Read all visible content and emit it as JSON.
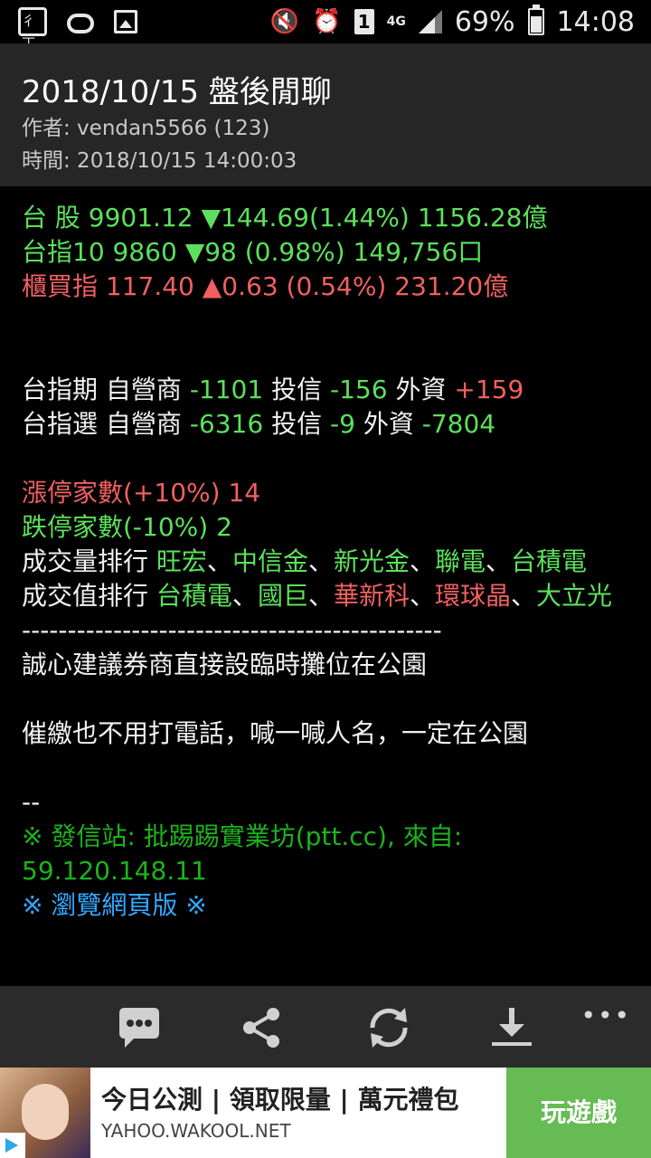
{
  "status_bar": {
    "battery": "69%",
    "time": "14:08",
    "sim_slot": "1",
    "network": "4G"
  },
  "header": {
    "title": "2018/10/15 盤後閒聊",
    "author": "作者: vendan5566 (123)",
    "time": "時間: 2018/10/15 14:00:03"
  },
  "content": {
    "taiex": "台 股 9901.12 ▼144.69(1.44%) 1156.28億",
    "futures": "台指10 9860 ▼98 (0.98%) 149,756口",
    "otc": "櫃買指 117.40 ▲0.63 (0.54%) 231.20億",
    "fut_inst": {
      "label": "台指期 自營商 ",
      "dealer_val": "-1101",
      "trust_label": " 投信 ",
      "trust_val": "-156",
      "foreign_label": " 外資 ",
      "foreign_val": "+159"
    },
    "opt_inst": {
      "label": "台指選 自營商 ",
      "dealer_val": "-6316",
      "trust_label": " 投信 ",
      "trust_val": "-9",
      "foreign_label": " 外資 ",
      "foreign_val": "-7804"
    },
    "limit_up": "漲停家數(+10%) 14",
    "limit_down": "跌停家數(-10%) 2",
    "volume_rank": {
      "label": "成交量排行 ",
      "s1": "旺宏",
      "s2": "中信金",
      "s3": "新光金",
      "s4": "聯電",
      "s5": "台積電",
      "sep": "、"
    },
    "value_rank": {
      "label": "成交值排行 ",
      "s1": "台積電",
      "s2": "國巨",
      "s3": "華新科",
      "s4": "環球晶",
      "s5": "大立光",
      "sep": "、"
    },
    "divider": "----------------------------------------------",
    "body1": "誠心建議券商直接設臨時攤位在公園",
    "body2": "催繳也不用打電話，喊一喊人名，一定在公園",
    "sig": "--",
    "source": "※ 發信站: 批踢踢實業坊(ptt.cc), 來自: 59.120.148.11",
    "web_link": "※ 瀏覽網頁版 ※"
  },
  "toolbar": {
    "more": "•••"
  },
  "ad": {
    "title": "今日公測 | 領取限量 | 萬元禮包",
    "url": "YAHOO.WAKOOL.NET",
    "cta": "玩遊戲"
  },
  "colors": {
    "green": "#5ce05c",
    "red": "#f06060",
    "dark_green": "#1db31d",
    "link_blue": "#31a8ff",
    "header_bg": "#262626",
    "toolbar_bg": "#2b2b2b",
    "ad_cta": "#66bb55"
  }
}
